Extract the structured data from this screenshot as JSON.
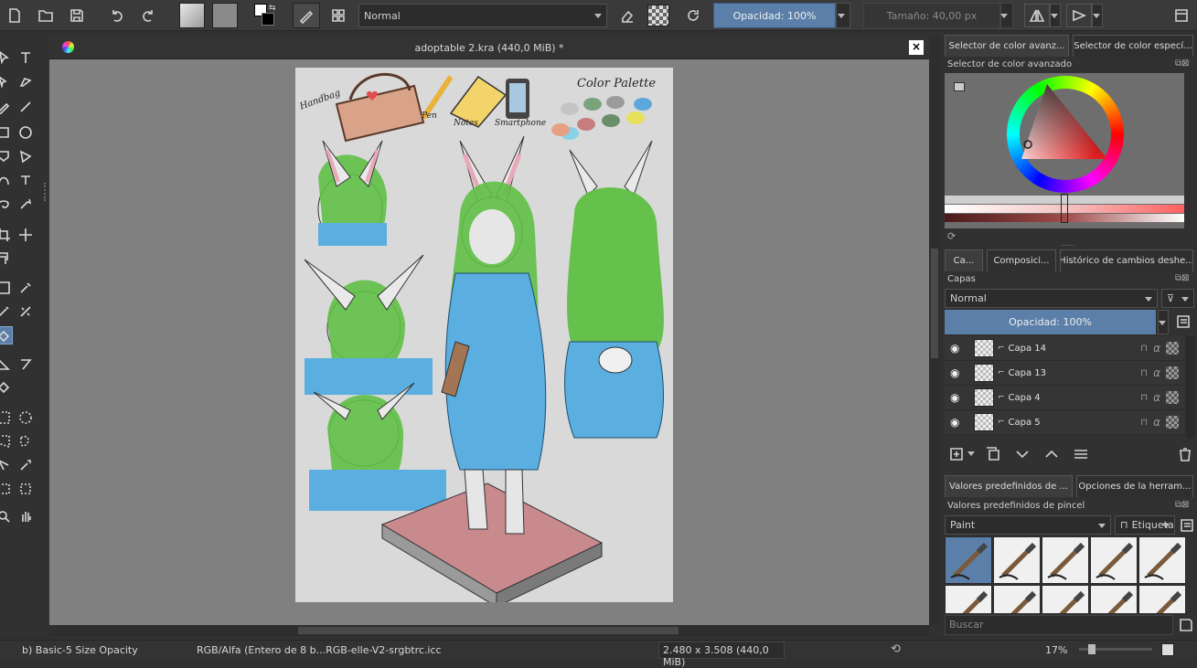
{
  "toolbar": {
    "blend_mode": "Normal",
    "opacity_label": "Opacidad: 100%",
    "size_label": "Tamaño: 40,00 px"
  },
  "document": {
    "title": "adoptable 2.kra (440,0 MiB) *"
  },
  "artwork": {
    "labels": [
      "Handbag",
      "Pen",
      "Notes",
      "Smartphone",
      "Color Palette"
    ],
    "palette_colors": [
      "#c5c5c5",
      "#7aa37a",
      "#9b9b9b",
      "#c87d7d",
      "#6a8d6a",
      "#e8e05a",
      "#8ad0e6",
      "#e8a082",
      "#5ba8dc"
    ]
  },
  "color_selector": {
    "tabs": [
      "Selector de color avanz...",
      "Selector de color especí..."
    ],
    "title": "Selector de color avanzado"
  },
  "layers_panel": {
    "tabs": [
      "Ca...",
      "Composici...",
      "Histórico de cambios deshe..."
    ],
    "title": "Capas",
    "blend_mode": "Normal",
    "opacity_label": "Opacidad:  100%",
    "layers": [
      {
        "name": "Capa 14"
      },
      {
        "name": "Capa 13"
      },
      {
        "name": "Capa 4"
      },
      {
        "name": "Capa 5"
      }
    ]
  },
  "brush_presets": {
    "tabs": [
      "Valores predefinidos de ...",
      "Opciones de la herram..."
    ],
    "title": "Valores predefinidos de pincel",
    "filter": "Paint",
    "tag_label": "Etiqueta",
    "search_placeholder": "Buscar"
  },
  "statusbar": {
    "brush": "b) Basic-5 Size Opacity",
    "color_profile": "RGB/Alfa (Entero de 8 b...RGB-elle-V2-srgbtrc.icc",
    "image_size": "2.480 x 3.508 (440,0 MiB)",
    "zoom": "17%"
  },
  "colors": {
    "accent": "#5b7fa8",
    "hair": "#5fbf45",
    "dress": "#5aaee0",
    "floor": "#c98a8e"
  }
}
